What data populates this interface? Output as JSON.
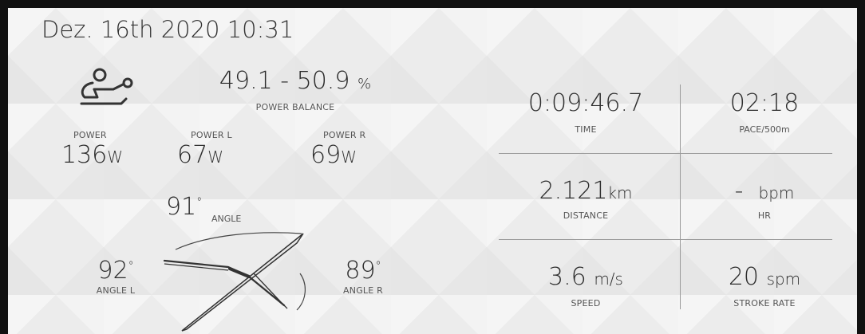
{
  "header": {
    "date": "Dez. 16th 2020 10:31"
  },
  "icons": {
    "rower": "rower-icon",
    "boat": "boat-top-view-icon"
  },
  "balance": {
    "value": "49.1 - 50.9",
    "unit": "%",
    "label": "POWER BALANCE"
  },
  "power": {
    "total": {
      "label": "POWER",
      "value": "136",
      "unit": "W"
    },
    "left": {
      "label": "POWER L",
      "value": "67",
      "unit": "W"
    },
    "right": {
      "label": "POWER R",
      "value": "69",
      "unit": "W"
    }
  },
  "angles": {
    "total": {
      "value": "91",
      "unit": "°",
      "label": "ANGLE"
    },
    "left": {
      "value": "92",
      "unit": "°",
      "label": "ANGLE L"
    },
    "right": {
      "value": "89",
      "unit": "°",
      "label": "ANGLE R"
    }
  },
  "stats": {
    "time": {
      "value": "0:09:46.7",
      "label": "TIME"
    },
    "pace": {
      "value": "02:18",
      "label": "PACE/500m"
    },
    "distance": {
      "value": "2.121",
      "unit": "km",
      "label": "DISTANCE"
    },
    "hr": {
      "value": "-",
      "unit": "bpm",
      "label": "HR"
    },
    "speed": {
      "value": "3.6",
      "unit": "m/s",
      "label": "SPEED"
    },
    "stroke_rate": {
      "value": "20",
      "unit": "spm",
      "label": "STROKE RATE"
    }
  }
}
